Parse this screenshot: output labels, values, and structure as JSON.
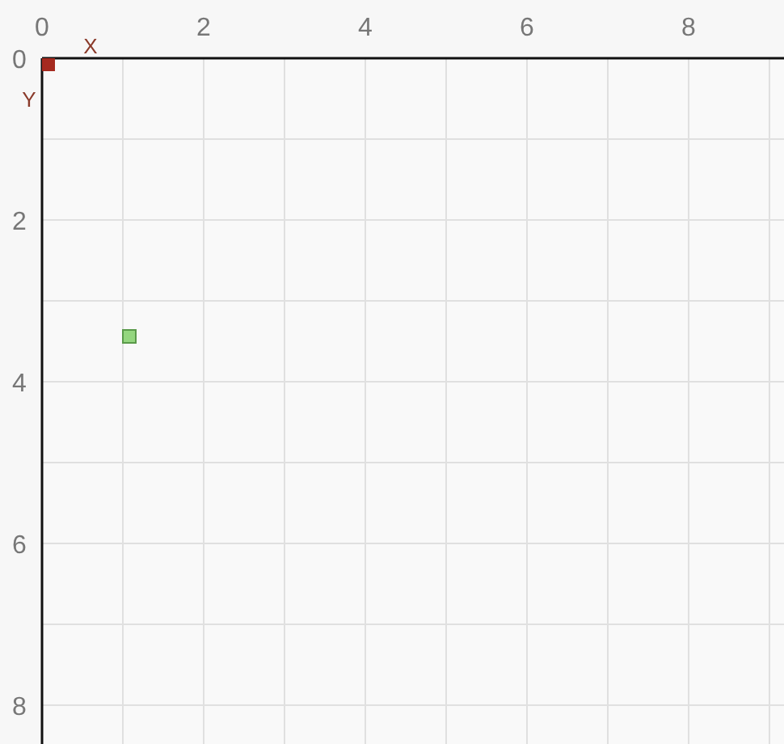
{
  "canvas": {
    "chart_data": {
      "type": "scatter",
      "xlabel": "X",
      "ylabel": "Y",
      "xlim": [
        0,
        9.18
      ],
      "ylim": [
        8.48,
        0
      ],
      "grid": true,
      "xticks": [
        {
          "value": 0,
          "label": "0"
        },
        {
          "value": 2,
          "label": "2"
        },
        {
          "value": 4,
          "label": "4"
        },
        {
          "value": 6,
          "label": "6"
        },
        {
          "value": 8,
          "label": "8"
        }
      ],
      "yticks": [
        {
          "value": 0,
          "label": "0"
        },
        {
          "value": 2,
          "label": "2"
        },
        {
          "value": 4,
          "label": "4"
        },
        {
          "value": 6,
          "label": "6"
        },
        {
          "value": 8,
          "label": "8"
        }
      ],
      "series": [
        {
          "color": "#a52a1f",
          "x": [
            0.08
          ],
          "values": [
            0.08
          ]
        },
        {
          "color": "#94d67f",
          "x": [
            1.08
          ],
          "values": [
            3.44
          ]
        }
      ]
    }
  }
}
